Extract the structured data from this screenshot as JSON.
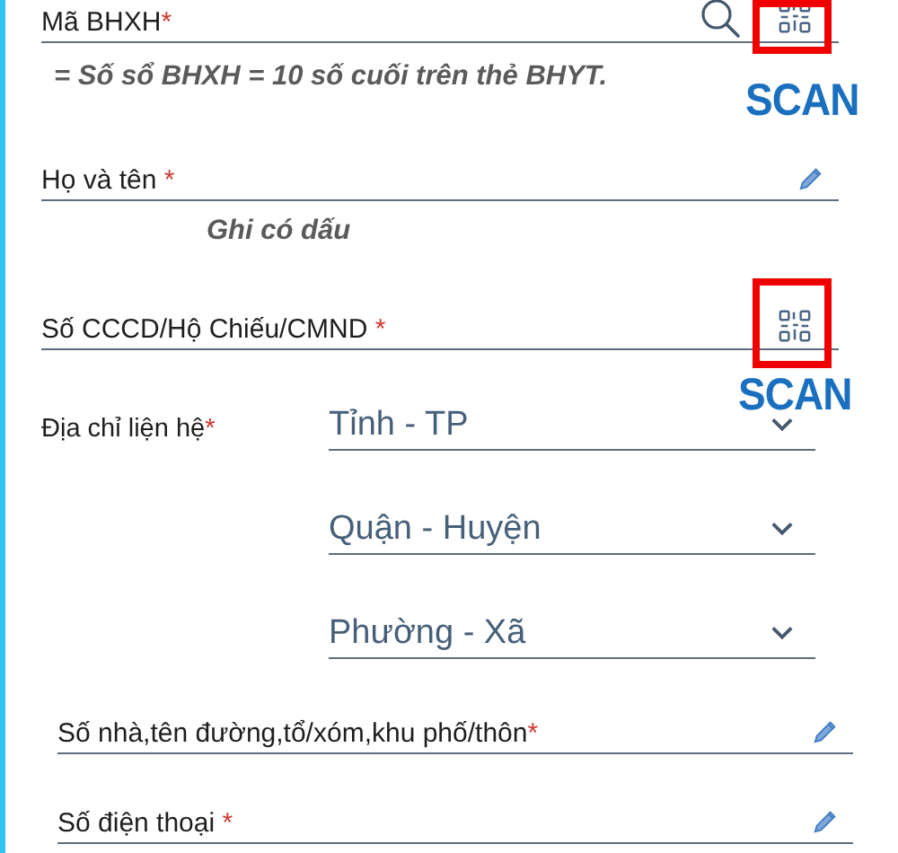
{
  "fields": [
    {
      "kind": "input",
      "label": "Mã BHXH",
      "required_mark": "*",
      "actions": [
        {
          "kind": "search"
        },
        {
          "kind": "qr"
        }
      ],
      "highlighted": true,
      "scan": "SCAN",
      "note": "= Số sổ BHXH = 10 số cuối trên thẻ BHYT."
    },
    {
      "kind": "input",
      "label": "Họ và tên ",
      "required_mark": "*",
      "actions": [
        {
          "kind": "edit"
        }
      ],
      "highlighted": false,
      "note": "Ghi có dấu"
    },
    {
      "kind": "input",
      "label": "Số CCCD/Hộ Chiếu/CMND ",
      "required_mark": "*",
      "actions": [
        {
          "kind": "qr"
        }
      ],
      "highlighted": true,
      "scan": "SCAN"
    },
    {
      "kind": "address",
      "label": "Địa chỉ liện hệ",
      "required_mark": "*",
      "selects": [
        {
          "placeholder": "Tỉnh - TP"
        },
        {
          "placeholder": "Quận - Huyện"
        },
        {
          "placeholder": "Phường - Xã"
        }
      ]
    },
    {
      "kind": "input",
      "label": "Số nhà,tên đường,tổ/xóm,khu phố/thôn",
      "required_mark": "*",
      "actions": [
        {
          "kind": "edit"
        }
      ],
      "highlighted": false
    },
    {
      "kind": "input",
      "label": "Số điện thoại ",
      "required_mark": "*",
      "actions": [
        {
          "kind": "edit"
        }
      ],
      "highlighted": false
    }
  ]
}
